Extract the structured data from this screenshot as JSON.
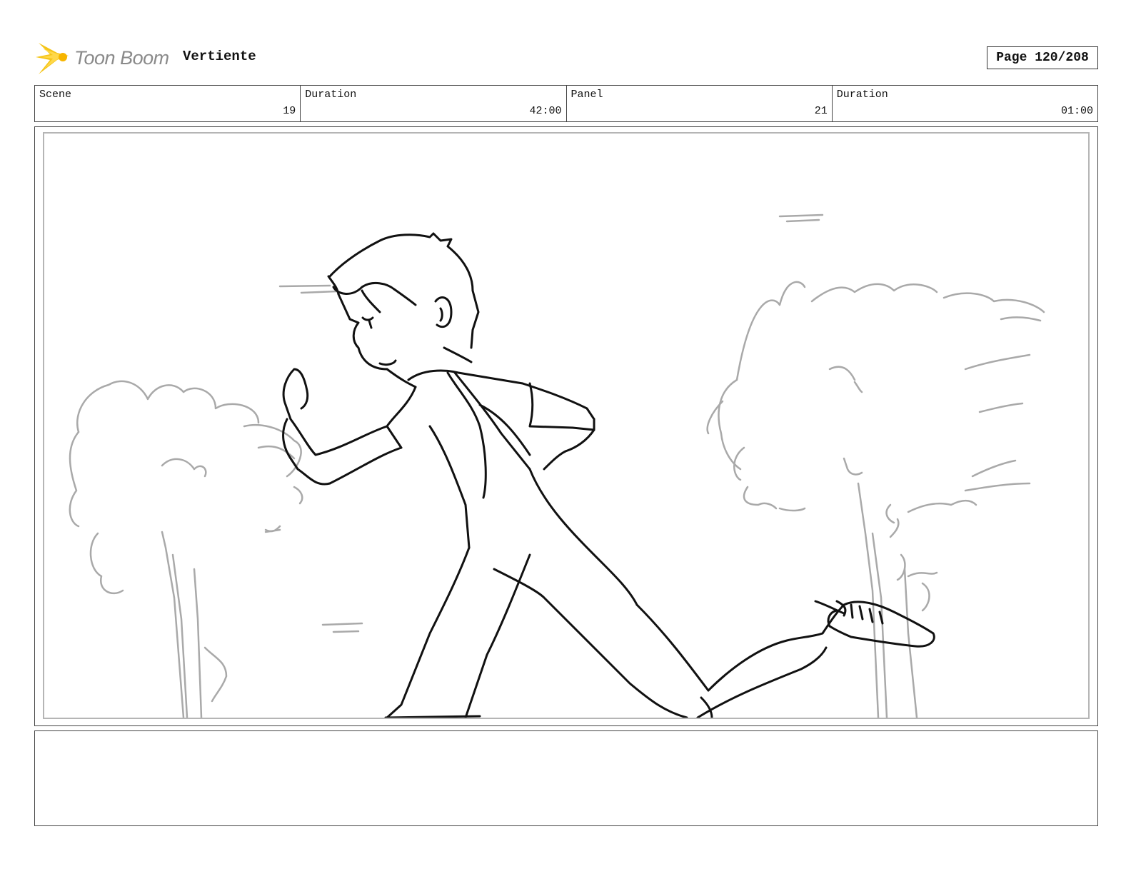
{
  "header": {
    "logo_text": "Toon Boom",
    "logo_icon": "toon-boom-burst-icon",
    "project_title": "Vertiente",
    "page_label": "Page 120/208"
  },
  "info_bar": {
    "scene_label": "Scene",
    "scene_value": "19",
    "scene_duration_label": "Duration",
    "scene_duration_value": "42:00",
    "panel_label": "Panel",
    "panel_value": "21",
    "panel_duration_label": "Duration",
    "panel_duration_value": "01:00"
  },
  "panel": {
    "sketch": "running-boy-sketch"
  },
  "notes": {
    "text": ""
  },
  "colors": {
    "logo_accent": "#f5c518",
    "ink": "#111111",
    "sketch_gray": "#a9a9a9"
  }
}
